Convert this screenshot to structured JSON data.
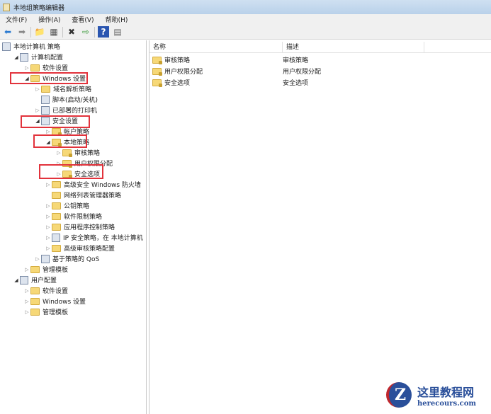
{
  "window": {
    "title": "本地组策略编辑器"
  },
  "menu": [
    "文件(F)",
    "操作(A)",
    "查看(V)",
    "帮助(H)"
  ],
  "toolbar": [
    {
      "icon": "back-arrow-icon",
      "glyph": "⬅"
    },
    {
      "icon": "forward-arrow-icon",
      "glyph": "➡"
    },
    {
      "icon": "up-folder-icon",
      "glyph": "📁"
    },
    {
      "icon": "show-hide-tree-icon",
      "glyph": "▦"
    },
    {
      "icon": "delete-icon",
      "glyph": "✖"
    },
    {
      "icon": "export-list-icon",
      "glyph": "⇨"
    },
    {
      "icon": "help-icon",
      "glyph": "?"
    },
    {
      "icon": "properties-icon",
      "glyph": "▤"
    }
  ],
  "tree": [
    {
      "label": "本地计算机 策略",
      "level": 0,
      "arrow": "none",
      "icon": "policy"
    },
    {
      "label": "计算机配置",
      "level": 1,
      "arrow": "open",
      "icon": "computer"
    },
    {
      "label": "软件设置",
      "level": 2,
      "arrow": "closed",
      "icon": "folder"
    },
    {
      "label": "Windows 设置",
      "level": 2,
      "arrow": "open",
      "icon": "folder"
    },
    {
      "label": "域名解析策略",
      "level": 3,
      "arrow": "closed",
      "icon": "folder"
    },
    {
      "label": "脚本(启动/关机)",
      "level": 3,
      "arrow": "none",
      "icon": "script"
    },
    {
      "label": "已部署的打印机",
      "level": 3,
      "arrow": "closed",
      "icon": "printer"
    },
    {
      "label": "安全设置",
      "level": 3,
      "arrow": "open",
      "icon": "security"
    },
    {
      "label": "帐户策略",
      "level": 4,
      "arrow": "closed",
      "icon": "lockfolder"
    },
    {
      "label": "本地策略",
      "level": 4,
      "arrow": "open",
      "icon": "lockfolder"
    },
    {
      "label": "审核策略",
      "level": 5,
      "arrow": "closed",
      "icon": "lockfolder"
    },
    {
      "label": "用户权限分配",
      "level": 5,
      "arrow": "closed",
      "icon": "lockfolder"
    },
    {
      "label": "安全选项",
      "level": 5,
      "arrow": "closed",
      "icon": "lockfolder"
    },
    {
      "label": "高级安全 Windows 防火墙",
      "level": 4,
      "arrow": "closed",
      "icon": "folder"
    },
    {
      "label": "网络列表管理器策略",
      "level": 4,
      "arrow": "none",
      "icon": "folder"
    },
    {
      "label": "公钥策略",
      "level": 4,
      "arrow": "closed",
      "icon": "folder"
    },
    {
      "label": "软件限制策略",
      "level": 4,
      "arrow": "closed",
      "icon": "folder"
    },
    {
      "label": "应用程序控制策略",
      "level": 4,
      "arrow": "closed",
      "icon": "folder"
    },
    {
      "label": "IP 安全策略，在 本地计算机",
      "level": 4,
      "arrow": "closed",
      "icon": "ipsec"
    },
    {
      "label": "高级审核策略配置",
      "level": 4,
      "arrow": "closed",
      "icon": "folder"
    },
    {
      "label": "基于策略的 QoS",
      "level": 3,
      "arrow": "closed",
      "icon": "chart"
    },
    {
      "label": "管理模板",
      "level": 2,
      "arrow": "closed",
      "icon": "folder"
    },
    {
      "label": "用户配置",
      "level": 1,
      "arrow": "open",
      "icon": "user"
    },
    {
      "label": "软件设置",
      "level": 2,
      "arrow": "closed",
      "icon": "folder"
    },
    {
      "label": "Windows 设置",
      "level": 2,
      "arrow": "closed",
      "icon": "folder"
    },
    {
      "label": "管理模板",
      "level": 2,
      "arrow": "closed",
      "icon": "folder"
    }
  ],
  "list": {
    "columns": [
      "名称",
      "描述"
    ],
    "rows": [
      {
        "name": "审核策略",
        "desc": "审核策略"
      },
      {
        "name": "用户权限分配",
        "desc": "用户权限分配"
      },
      {
        "name": "安全选项",
        "desc": "安全选项"
      }
    ]
  },
  "watermark": {
    "logo_letter": "Z",
    "title": "这里教程网",
    "subtitle": "herecours.com"
  }
}
